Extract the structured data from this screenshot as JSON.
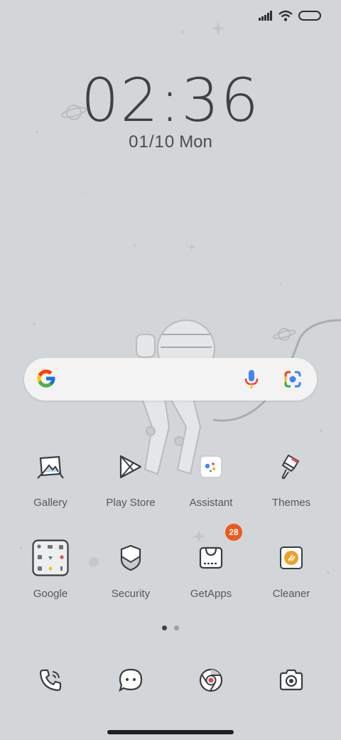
{
  "status_bar": {
    "signal_icon": "signal-bars-icon",
    "wifi_icon": "wifi-icon",
    "battery_icon": "battery-icon"
  },
  "clock": {
    "time": "02:36",
    "date": "01/10",
    "weekday": "Mon"
  },
  "search_bar": {
    "logo_icon": "google-g-icon",
    "voice_icon": "microphone-icon",
    "lens_icon": "google-lens-icon"
  },
  "apps": [
    {
      "label": "Gallery",
      "icon": "gallery-icon"
    },
    {
      "label": "Play Store",
      "icon": "play-store-icon"
    },
    {
      "label": "Assistant",
      "icon": "assistant-icon"
    },
    {
      "label": "Themes",
      "icon": "themes-brush-icon"
    },
    {
      "label": "Google",
      "icon": "google-folder-icon"
    },
    {
      "label": "Security",
      "icon": "security-shield-icon"
    },
    {
      "label": "GetApps",
      "icon": "getapps-bag-icon",
      "badge": "28"
    },
    {
      "label": "Cleaner",
      "icon": "cleaner-broom-icon"
    }
  ],
  "page_indicator": {
    "pages": 2,
    "current": 1
  },
  "dock": [
    {
      "icon": "phone-icon"
    },
    {
      "icon": "messages-icon"
    },
    {
      "icon": "chrome-icon"
    },
    {
      "icon": "camera-icon"
    }
  ],
  "colors": {
    "background": "#d3d6d8",
    "badge": "#ea5a1e",
    "google_blue": "#4285F4",
    "google_red": "#EA4335",
    "google_yellow": "#FBBC05",
    "google_green": "#34A853"
  }
}
